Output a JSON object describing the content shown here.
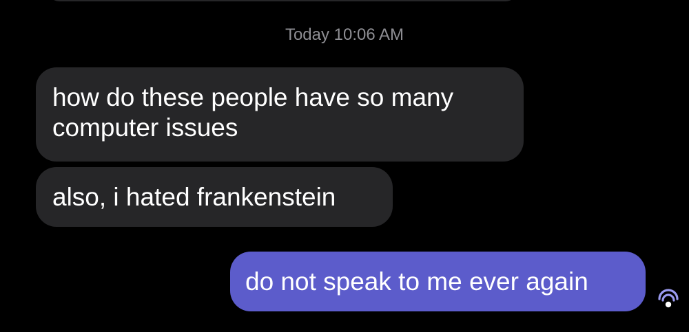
{
  "conversation": {
    "timestamp": "Today 10:06 AM",
    "messages": [
      {
        "direction": "incoming",
        "text": "how do these people have so many computer issues"
      },
      {
        "direction": "incoming",
        "text": "also, i hated frankenstein"
      },
      {
        "direction": "outgoing",
        "text": "do not speak to me ever again"
      }
    ],
    "read_indicator_icon": "read-receipt-icon"
  },
  "colors": {
    "background": "#000000",
    "incoming_bubble": "#262628",
    "outgoing_bubble": "#5c5ccb",
    "timestamp_text": "#8e8e93",
    "message_text": "#ffffff"
  }
}
